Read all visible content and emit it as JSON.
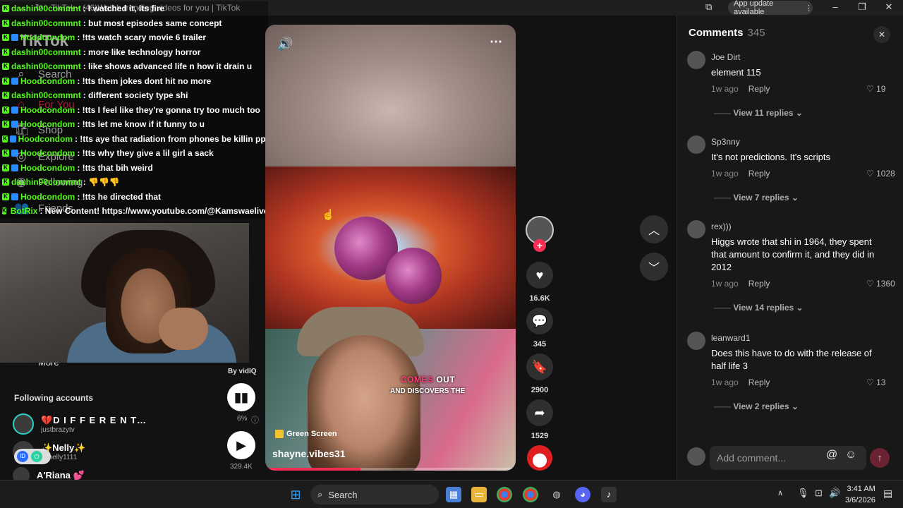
{
  "window": {
    "title": "TikTok - (46)Watch trending videos for you | TikTok",
    "app_update": "App update available"
  },
  "sidebar": {
    "logo": "TikTok",
    "nav": [
      {
        "label": "Search",
        "icon": "search-icon"
      },
      {
        "label": "For You",
        "icon": "home-icon"
      },
      {
        "label": "Shop",
        "icon": "shop-icon"
      },
      {
        "label": "Explore",
        "icon": "compass-icon"
      },
      {
        "label": "Following",
        "icon": "following-icon"
      },
      {
        "label": "Friends",
        "icon": "friends-icon"
      },
      {
        "label": "More",
        "icon": "more-icon"
      }
    ],
    "following_title": "Following accounts",
    "accounts": [
      {
        "name": "💔D I F F E R E N T…",
        "handle": "justbrazytv"
      },
      {
        "name": "✨Nelly✨",
        "handle": "z_nelly1111"
      },
      {
        "name": "A'Riana 💕",
        "handle": ""
      }
    ],
    "vidiq": {
      "label": "By vidIQ",
      "percent": "6%",
      "views": "329.4K"
    }
  },
  "chat": [
    {
      "user": "dashin00commnt",
      "msg": ": I watched it, its fire"
    },
    {
      "user": "dashin00commnt",
      "msg": ": but most episodes same concept"
    },
    {
      "user": "Hoodcondom",
      "msg": ": !tts watch scary movie 6 trailer"
    },
    {
      "user": "dashin00commnt",
      "msg": ": more like technology horror"
    },
    {
      "user": "dashin00commnt",
      "msg": ": like shows advanced life n how it drain u"
    },
    {
      "user": "Hoodcondom",
      "msg": ": !tts them jokes dont hit no more"
    },
    {
      "user": "dashin00commnt",
      "msg": ": different society type shi"
    },
    {
      "user": "Hoodcondom",
      "msg": ": !tts I feel like they're gonna try too much too"
    },
    {
      "user": "Hoodcondom",
      "msg": ": !tts let me know if it funny to u"
    },
    {
      "user": "Hoodcondom",
      "msg": ": !tts aye that radiation from phones be killin ppl"
    },
    {
      "user": "Hoodcondom",
      "msg": ": !tts why they give a lil girl a sack"
    },
    {
      "user": "Hoodcondom",
      "msg": ": !tts that bih weird"
    },
    {
      "user": "dashin00commnt",
      "msg": ": 👎👎👎"
    },
    {
      "user": "Hoodcondom",
      "msg": ": !tts he directed that"
    },
    {
      "user": "BotRix",
      "msg": ": New Content! https://www.youtube.com/@Kamswaelive"
    }
  ],
  "video": {
    "caption_highlight": "COMES",
    "caption_rest": " OUT",
    "caption_line2": "AND DISCOVERS THE",
    "tag": "Green Screen",
    "author": "shayne.vibes31",
    "progress": 0.38
  },
  "actions": {
    "likes": "16.6K",
    "comments": "345",
    "saves": "2900",
    "shares": "1529"
  },
  "comments_panel": {
    "title": "Comments",
    "count": "345",
    "input_placeholder": "Add comment...",
    "items": [
      {
        "user": "Joe Dirt",
        "text": "element 115",
        "time": "1w ago",
        "reply": "Reply",
        "likes": "19",
        "view_replies": "View 11 replies"
      },
      {
        "user": "Sp3nny",
        "text": "It's not predictions. It's scripts",
        "time": "1w ago",
        "reply": "Reply",
        "likes": "1028",
        "view_replies": "View 7 replies"
      },
      {
        "user": "rex)))",
        "text": "Higgs wrote that shi in 1964, they spent that amount to confirm it, and they did in 2012",
        "time": "1w ago",
        "reply": "Reply",
        "likes": "1360",
        "view_replies": "View 14 replies"
      },
      {
        "user": "leanward1",
        "text": "Does this have to do with the release of half life 3",
        "time": "1w ago",
        "reply": "Reply",
        "likes": "13",
        "view_replies": "View 2 replies"
      }
    ]
  },
  "taskbar": {
    "search": "Search",
    "time": "3:41 AM",
    "date": "3/6/2026"
  }
}
